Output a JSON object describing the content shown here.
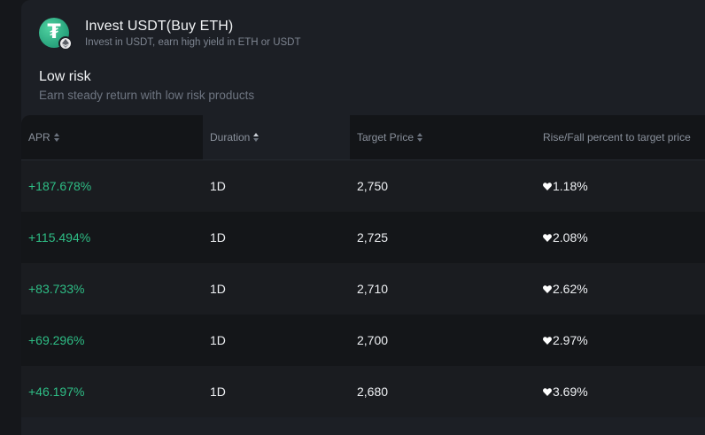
{
  "product": {
    "title": "Invest USDT(Buy ETH)",
    "subtitle": "Invest in USDT, earn high yield in ETH or USDT",
    "icon": "usdt-coin-icon",
    "badge_icon": "eth-badge-icon"
  },
  "section": {
    "title": "Low risk",
    "subtitle": "Earn steady return with low risk products"
  },
  "table": {
    "headers": {
      "apr": "APR",
      "duration": "Duration",
      "target_price": "Target Price",
      "rise_fall": "Rise/Fall percent to target price"
    },
    "rows": [
      {
        "apr": "+187.678%",
        "duration": "1D",
        "target_price": "2,750",
        "rise_fall": "1.18%"
      },
      {
        "apr": "+115.494%",
        "duration": "1D",
        "target_price": "2,725",
        "rise_fall": "2.08%"
      },
      {
        "apr": "+83.733%",
        "duration": "1D",
        "target_price": "2,710",
        "rise_fall": "2.62%"
      },
      {
        "apr": "+69.296%",
        "duration": "1D",
        "target_price": "2,700",
        "rise_fall": "2.97%"
      },
      {
        "apr": "+46.197%",
        "duration": "1D",
        "target_price": "2,680",
        "rise_fall": "3.69%"
      }
    ]
  },
  "colors": {
    "apr_green": "#2ebd85",
    "usdt_green": "#26a17b",
    "panel_bg": "#1c1f25"
  }
}
